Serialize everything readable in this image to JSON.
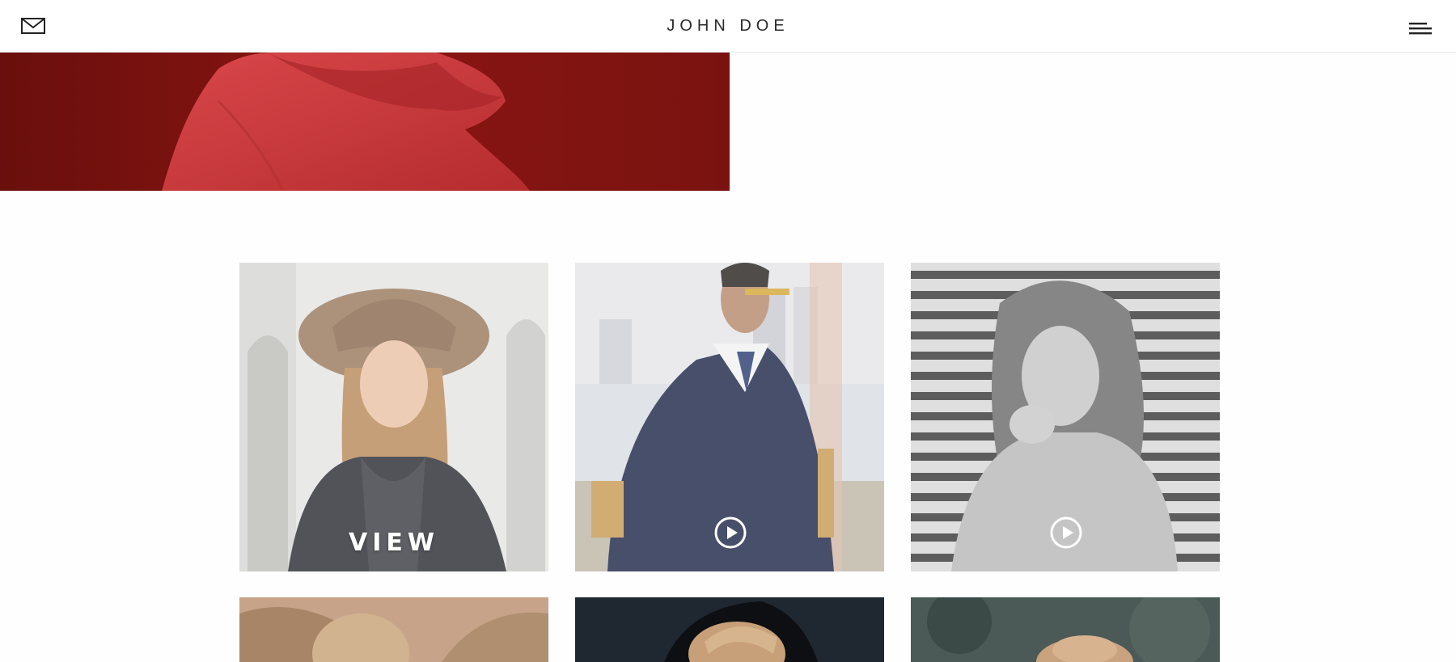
{
  "header": {
    "brand": "JOHN DOE",
    "icons": {
      "left": "mail-icon",
      "right": "hamburger-menu-icon"
    }
  },
  "gallery": {
    "items": [
      {
        "overlay": "VIEW",
        "kind": "photo",
        "tone": "color"
      },
      {
        "overlay": "",
        "kind": "video",
        "tone": "color",
        "icon": "play-circle-icon"
      },
      {
        "overlay": "",
        "kind": "video",
        "tone": "grayscale",
        "icon": "play-circle-icon"
      },
      {
        "overlay": "",
        "kind": "photo",
        "tone": "color"
      },
      {
        "overlay": "",
        "kind": "photo",
        "tone": "color"
      },
      {
        "overlay": "",
        "kind": "photo",
        "tone": "color"
      }
    ]
  },
  "colors": {
    "hero_red": "#7a1310",
    "coat_red": "#c8393a",
    "header_bg": "#ffffff",
    "page_bg": "#fefefe"
  }
}
